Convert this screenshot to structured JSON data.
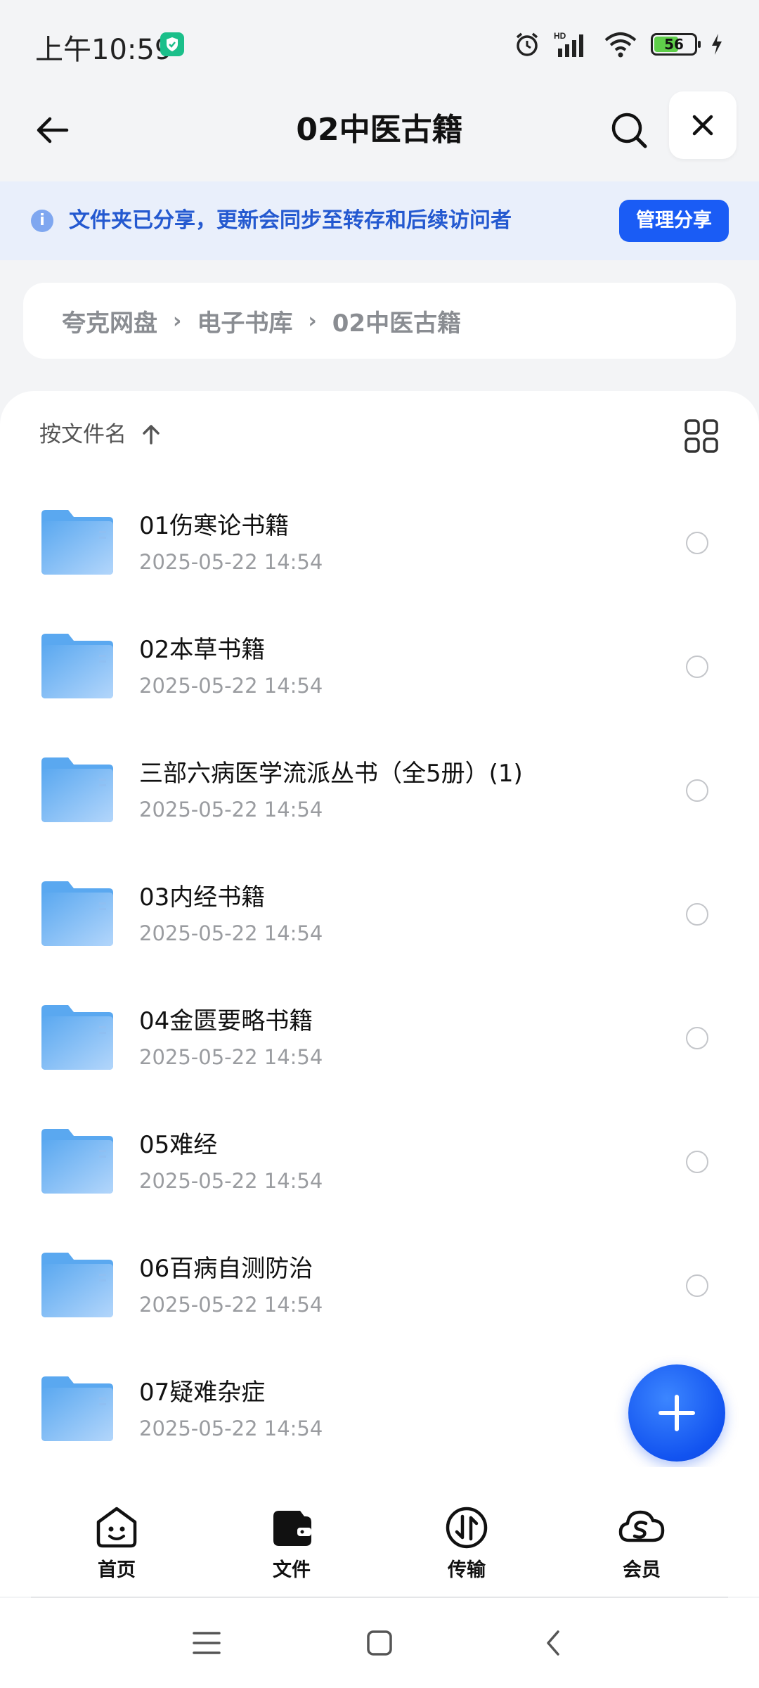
{
  "status_bar": {
    "time": "上午10:59",
    "battery": "56"
  },
  "header": {
    "title": "02中医古籍"
  },
  "banner": {
    "message": "文件夹已分享，更新会同步至转存和后续访问者",
    "action_label": "管理分享"
  },
  "breadcrumb": [
    "夸克网盘",
    "电子书库",
    "02中医古籍"
  ],
  "sort": {
    "label": "按文件名"
  },
  "files": [
    {
      "name": "01伤寒论书籍",
      "date": "2025-05-22 14:54"
    },
    {
      "name": "02本草书籍",
      "date": "2025-05-22 14:54"
    },
    {
      "name": "三部六病医学流派丛书（全5册）(1)",
      "date": "2025-05-22 14:54"
    },
    {
      "name": "03内经书籍",
      "date": "2025-05-22 14:54"
    },
    {
      "name": "04金匮要略书籍",
      "date": "2025-05-22 14:54"
    },
    {
      "name": "05难经",
      "date": "2025-05-22 14:54"
    },
    {
      "name": "06百病自测防治",
      "date": "2025-05-22 14:54"
    },
    {
      "name": "07疑难杂症",
      "date": "2025-05-22 14:54"
    }
  ],
  "bottom_nav": [
    {
      "label": "首页",
      "icon": "home-face-icon"
    },
    {
      "label": "文件",
      "icon": "wallet-folder-icon"
    },
    {
      "label": "传输",
      "icon": "transfer-icon"
    },
    {
      "label": "会员",
      "icon": "cloud-vip-icon"
    }
  ],
  "colors": {
    "accent": "#1a5cf5",
    "banner_bg": "#e9effb",
    "banner_text": "#2459d0",
    "folder": "#5aa8f0"
  }
}
